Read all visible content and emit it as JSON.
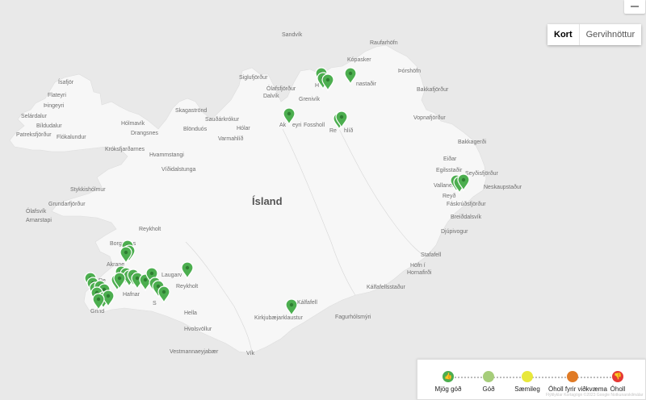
{
  "map_labels": [
    {
      "id": "island",
      "text": "Ísland"
    },
    {
      "id": "sandvik",
      "text": "Sandvík"
    },
    {
      "id": "raufarhofn",
      "text": "Raufarhöfn"
    },
    {
      "id": "kopasker",
      "text": "Kópasker"
    },
    {
      "id": "thorshofn",
      "text": "Þórshöfn"
    },
    {
      "id": "bakkafjordur",
      "text": "Bakkafjörður"
    },
    {
      "id": "vopnafjordur",
      "text": "Vopnafjörður"
    },
    {
      "id": "bakkagerdi",
      "text": "Bakkagerði"
    },
    {
      "id": "eidar",
      "text": "Eiðar"
    },
    {
      "id": "egilsstadir",
      "text": "Egilsstaðir"
    },
    {
      "id": "seydisfjordur",
      "text": "Seyðisfjörður"
    },
    {
      "id": "vallanes",
      "text": "Vallanes"
    },
    {
      "id": "neskaupstadur",
      "text": "Neskaupstaður"
    },
    {
      "id": "reydarfjordur",
      "text": "Reyð"
    },
    {
      "id": "faskrudsfjordur",
      "text": "Fáskrúðsfjörður"
    },
    {
      "id": "breiddalsvik",
      "text": "Breiðdalsvík"
    },
    {
      "id": "djupivogur",
      "text": "Djúpivogur"
    },
    {
      "id": "stafafell",
      "text": "Stafafell"
    },
    {
      "id": "hofn",
      "text": "Höfn í"
    },
    {
      "id": "hornafjordur",
      "text": "Hornafirði"
    },
    {
      "id": "kalfafellsstadur",
      "text": "Kálfafellsstaður"
    },
    {
      "id": "fagurholsmyri",
      "text": "Fagurhólsmýri"
    },
    {
      "id": "kalfafell",
      "text": "Kálfafell"
    },
    {
      "id": "kirkjubaejarklaustur",
      "text": "Kirkjubæjarklaustur"
    },
    {
      "id": "vik",
      "text": "Vík"
    },
    {
      "id": "vestmannaeyjabaer",
      "text": "Vestmannaeyjabær"
    },
    {
      "id": "hvolsvollur",
      "text": "Hvolsvöllur"
    },
    {
      "id": "hella",
      "text": "Hella"
    },
    {
      "id": "reykholt2",
      "text": "Reykholt"
    },
    {
      "id": "laugarvatn",
      "text": "Laugarv"
    },
    {
      "id": "selfoss",
      "text": "S"
    },
    {
      "id": "hafnarfjordur",
      "text": "Hafnar"
    },
    {
      "id": "reykjavik",
      "text": "Re"
    },
    {
      "id": "grindavik",
      "text": "Grind"
    },
    {
      "id": "akranes",
      "text": "Akrane"
    },
    {
      "id": "borgarnes",
      "text": "Borgarnes"
    },
    {
      "id": "reykholt",
      "text": "Reykholt"
    },
    {
      "id": "arnarstapi",
      "text": "Arnarstapi"
    },
    {
      "id": "olafsvik",
      "text": "Ólafsvík"
    },
    {
      "id": "grundarfjordur",
      "text": "Grundarfjörður"
    },
    {
      "id": "stykkisholmur",
      "text": "Stykkishólmur"
    },
    {
      "id": "vidhidalstunga",
      "text": "Víðidalstunga"
    },
    {
      "id": "hvammstangi",
      "text": "Hvammstangi"
    },
    {
      "id": "krokseyjarnes",
      "text": "Króksfjarðarnes"
    },
    {
      "id": "drangsnes",
      "text": "Drangsnes"
    },
    {
      "id": "holmavik",
      "text": "Hólmavík"
    },
    {
      "id": "flokalundur",
      "text": "Flókalundur"
    },
    {
      "id": "patreksfjordur",
      "text": "Patreksfjörður"
    },
    {
      "id": "bildudalur",
      "text": "Bíldudalur"
    },
    {
      "id": "selardalur",
      "text": "Selárdalur"
    },
    {
      "id": "thingeyri",
      "text": "Þingeyri"
    },
    {
      "id": "flateyri",
      "text": "Flateyri"
    },
    {
      "id": "isafjordur",
      "text": "Ísafjör"
    },
    {
      "id": "blonduos",
      "text": "Blönduós"
    },
    {
      "id": "skagastrond",
      "text": "Skagaströnd"
    },
    {
      "id": "saudarkrokur",
      "text": "Sauðárkrókur"
    },
    {
      "id": "holar",
      "text": "Hólar"
    },
    {
      "id": "varmahlid",
      "text": "Varmahlíð"
    },
    {
      "id": "siglufjordur",
      "text": "Siglufjörður"
    },
    {
      "id": "olafsfjordur",
      "text": "Ólafsfjörður"
    },
    {
      "id": "dalvik",
      "text": "Dalvík"
    },
    {
      "id": "grenivik",
      "text": "Grenivík"
    },
    {
      "id": "akureyri",
      "text": "Ak"
    },
    {
      "id": "akureyri2",
      "text": "eyri"
    },
    {
      "id": "fossholl",
      "text": "Fossholl"
    },
    {
      "id": "husavik",
      "text": "H"
    },
    {
      "id": "reykjahlid",
      "text": "Re"
    },
    {
      "id": "reykjahlid2",
      "text": "hlíð"
    },
    {
      "id": "asbyrgi",
      "text": "nastaðir"
    }
  ],
  "map_type_control": {
    "options": [
      "Kort",
      "Gervihnöttur"
    ],
    "selected": "Kort"
  },
  "legend": {
    "items": [
      {
        "label": "Mjög góð",
        "color": "#4cae4f",
        "icon": "thumbs-up-icon"
      },
      {
        "label": "Góð",
        "color": "#a6cd7a",
        "icon": "circle-icon"
      },
      {
        "label": "Sæmileg",
        "color": "#e8e83b",
        "icon": "circle-icon"
      },
      {
        "label": "Óholl fyrir viðkvæma",
        "color": "#e07b26",
        "icon": "circle-icon"
      },
      {
        "label": "Óholl",
        "color": "#e53935",
        "icon": "thumbs-down-icon"
      }
    ]
  },
  "attribution": "Flýtilyklar   Kortagögn ©2023 Google   Notkunarskilmálar",
  "marker_colors": {
    "very_good": "#4cae4f",
    "outline": "#2f7d32"
  }
}
